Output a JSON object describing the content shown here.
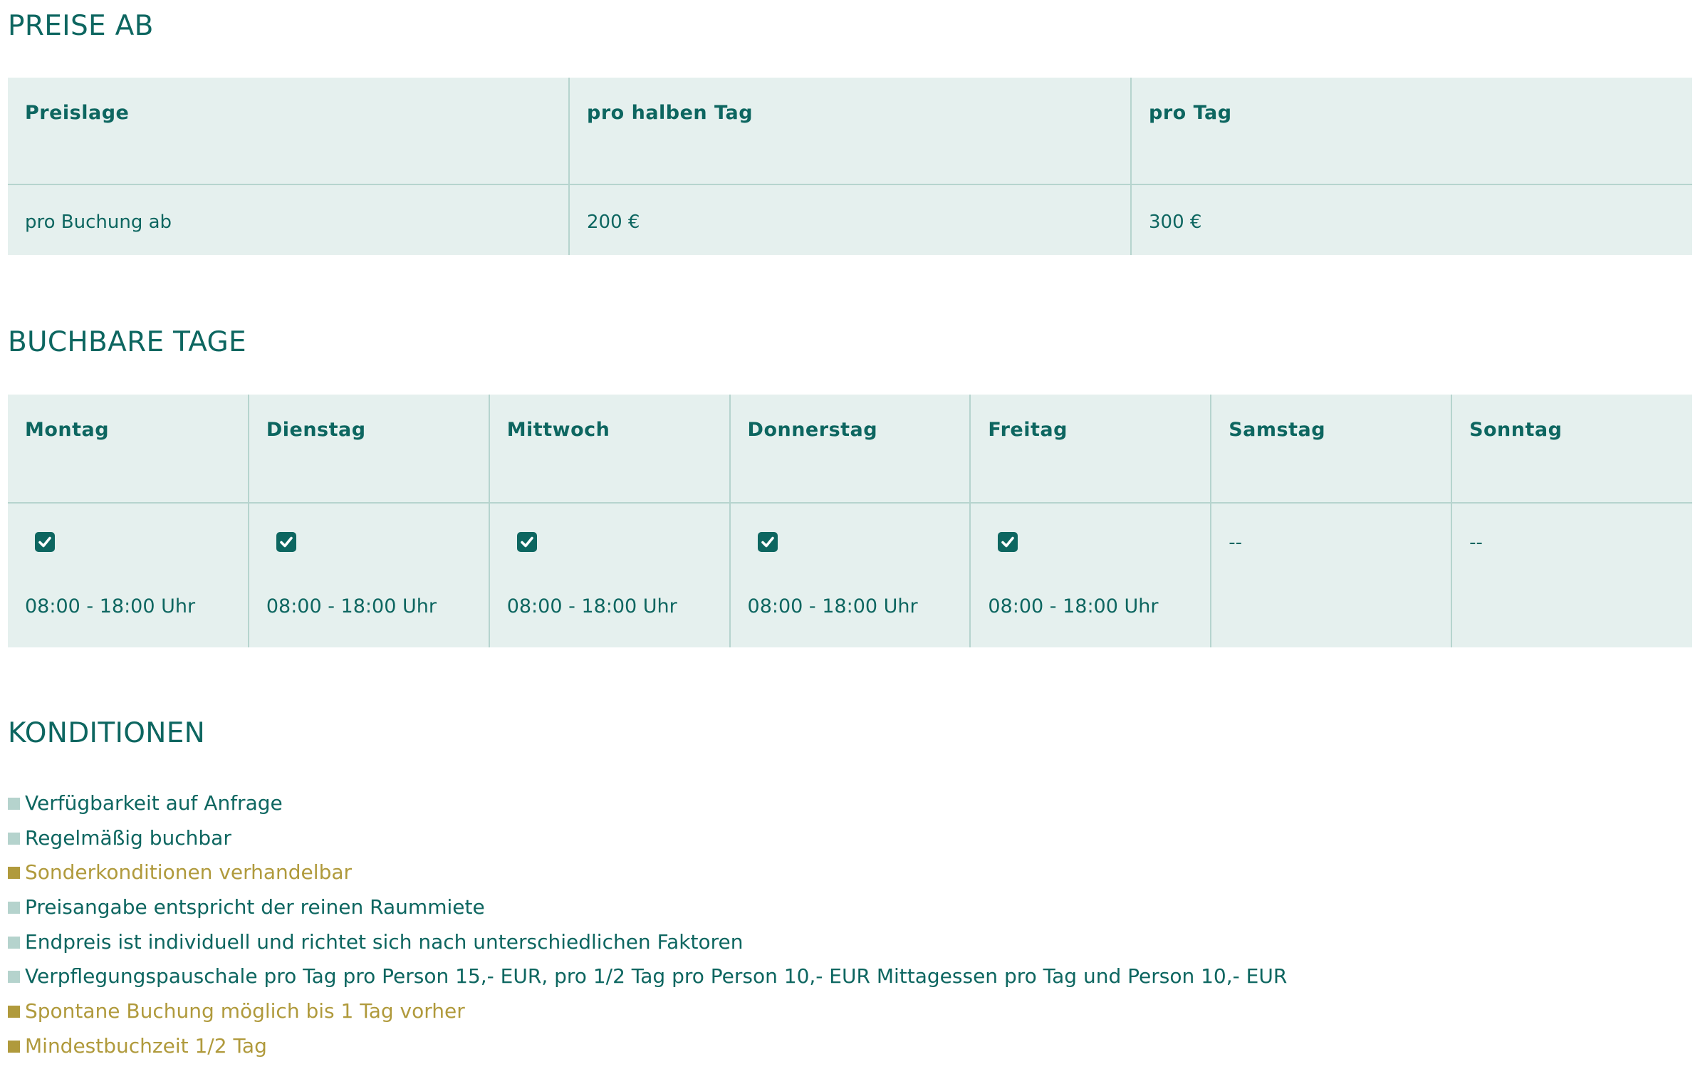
{
  "sections": {
    "prices_title": "PREISE AB",
    "days_title": "BUCHBARE TAGE",
    "conditions_title": "KONDITIONEN"
  },
  "price_table": {
    "headers": [
      "Preislage",
      "pro halben Tag",
      "pro Tag"
    ],
    "row": [
      "pro Buchung ab",
      "200 €",
      "300 €"
    ]
  },
  "days_table": {
    "headers": [
      "Montag",
      "Dienstag",
      "Mittwoch",
      "Donnerstag",
      "Freitag",
      "Samstag",
      "Sonntag"
    ],
    "days": [
      {
        "available": true,
        "time": "08:00 - 18:00 Uhr"
      },
      {
        "available": true,
        "time": "08:00 - 18:00 Uhr"
      },
      {
        "available": true,
        "time": "08:00 - 18:00 Uhr"
      },
      {
        "available": true,
        "time": "08:00 - 18:00 Uhr"
      },
      {
        "available": true,
        "time": "08:00 - 18:00 Uhr"
      },
      {
        "available": false,
        "text": "--"
      },
      {
        "available": false,
        "text": "--"
      }
    ],
    "checkbox_icon": "checkbox-checked-icon"
  },
  "conditions": [
    {
      "text": "Verfügbarkeit auf Anfrage",
      "style": "teal"
    },
    {
      "text": "Regelmäßig buchbar",
      "style": "teal"
    },
    {
      "text": "Sonderkonditionen verhandelbar",
      "style": "gold"
    },
    {
      "text": "Preisangabe entspricht der reinen Raummiete",
      "style": "teal"
    },
    {
      "text": "Endpreis ist individuell und richtet sich nach unterschiedlichen Faktoren",
      "style": "teal"
    },
    {
      "text": "Verpflegungspauschale pro Tag pro Person 15,- EUR, pro 1/2 Tag pro Person 10,- EUR Mittagessen pro Tag und Person 10,- EUR",
      "style": "teal"
    },
    {
      "text": "Spontane Buchung möglich bis 1 Tag vorher",
      "style": "gold"
    },
    {
      "text": "Mindestbuchzeit 1/2 Tag",
      "style": "gold"
    }
  ],
  "colors": {
    "primary": "#0d6660",
    "table_bg": "#e5f0ee",
    "border": "#b6d4ce",
    "accent_gold": "#b09a3c",
    "bullet_teal": "#b5d3cd"
  }
}
